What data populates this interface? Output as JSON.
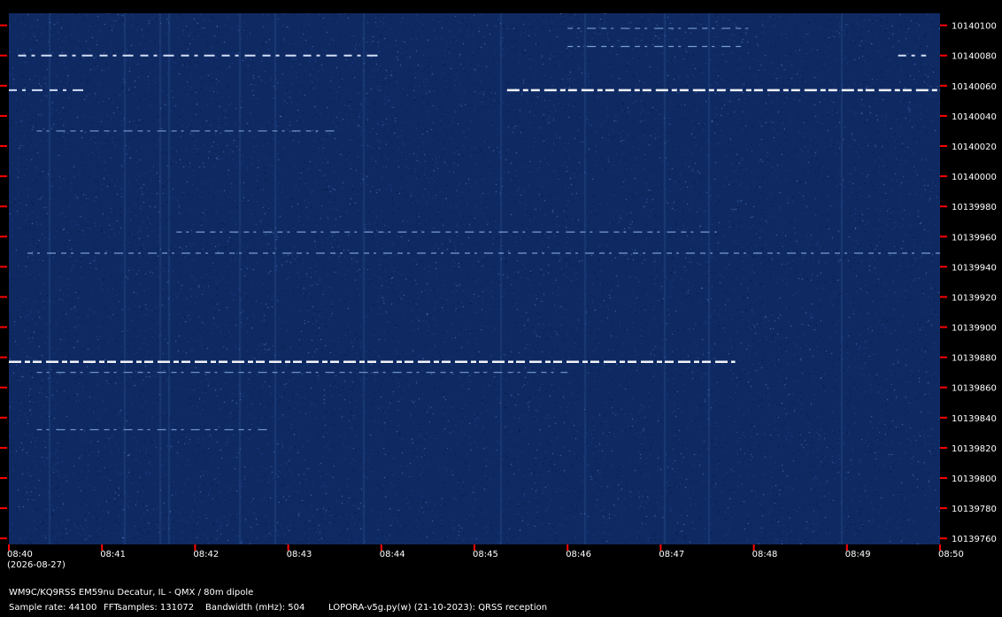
{
  "chart_data": {
    "type": "heatmap",
    "description_hidden": "",
    "x_axis": {
      "ticks": [
        "08:40",
        "08:41",
        "08:42",
        "08:43",
        "08:44",
        "08:45",
        "08:46",
        "08:47",
        "08:48",
        "08:49",
        "08:50"
      ],
      "date": "(2026-08-27)",
      "range": [
        "08:40",
        "08:50"
      ]
    },
    "y_axis": {
      "ticks": [
        10140100,
        10140080,
        10140060,
        10140040,
        10140020,
        10140000,
        10139980,
        10139960,
        10139940,
        10139920,
        10139900,
        10139880,
        10139860,
        10139840,
        10139820,
        10139800,
        10139780,
        10139760
      ],
      "range": [
        10139756,
        10140108
      ],
      "unit": "Hz"
    },
    "signals": [
      {
        "freq": 10140080,
        "start_min": 0.1,
        "end_min": 4.0,
        "strength": "medium"
      },
      {
        "freq": 10140057,
        "start_min": 0.0,
        "end_min": 0.8,
        "strength": "medium"
      },
      {
        "freq": 10140057,
        "start_min": 5.35,
        "end_min": 10.0,
        "strength": "strong"
      },
      {
        "freq": 10140030,
        "start_min": 0.3,
        "end_min": 3.5,
        "strength": "weak"
      },
      {
        "freq": 10139963,
        "start_min": 1.8,
        "end_min": 7.6,
        "strength": "weak"
      },
      {
        "freq": 10139949,
        "start_min": 0.2,
        "end_min": 10.0,
        "strength": "weak"
      },
      {
        "freq": 10139877,
        "start_min": 0.0,
        "end_min": 7.8,
        "strength": "strong"
      },
      {
        "freq": 10139870,
        "start_min": 0.3,
        "end_min": 6.0,
        "strength": "weak"
      },
      {
        "freq": 10139832,
        "start_min": 0.3,
        "end_min": 2.8,
        "strength": "weak"
      },
      {
        "freq": 10140098,
        "start_min": 6.0,
        "end_min": 8.0,
        "strength": "weak"
      },
      {
        "freq": 10140086,
        "start_min": 6.0,
        "end_min": 7.9,
        "strength": "weak"
      },
      {
        "freq": 10140080,
        "start_min": 9.55,
        "end_min": 9.85,
        "strength": "medium"
      }
    ]
  },
  "footer": {
    "station": "WM9C/KQ9RSS EM59nu Decatur, IL - QMX / 80m dipole",
    "sample_rate": "Sample rate: 44100",
    "fft_samples": "FFTsamples: 131072",
    "bandwidth": "Bandwidth (mHz): 504",
    "software": "LOPORA-v5g.py(w) (21-10-2023): QRSS reception"
  },
  "colors": {
    "background": "#000000",
    "waterfall_base": "#0f2a63",
    "tick_mark": "#ff0000",
    "text": "#ffffff"
  }
}
